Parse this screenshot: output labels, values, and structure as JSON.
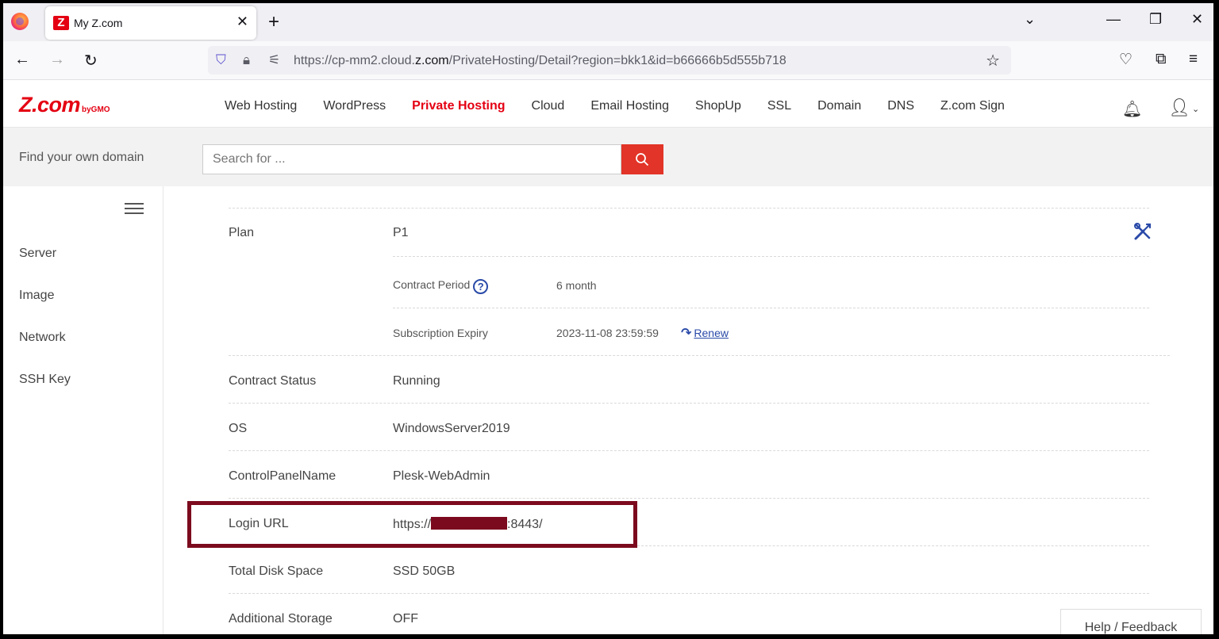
{
  "browser": {
    "tab_title": "My Z.com",
    "tab_favicon": "Z",
    "url_prefix": "https://cp-mm2.cloud.",
    "url_domain": "z.com",
    "url_suffix": "/PrivateHosting/Detail?region=bkk1&id=b66666b5d555b718"
  },
  "site": {
    "logo_text": "Z.com",
    "logo_sub": "byGMO",
    "menu": [
      "Web Hosting",
      "WordPress",
      "Private Hosting",
      "Cloud",
      "Email Hosting",
      "ShopUp",
      "SSL",
      "Domain",
      "DNS",
      "Z.com Sign"
    ],
    "active_menu": "Private Hosting",
    "accent_color": "#e40012"
  },
  "domain_search": {
    "label": "Find your own domain",
    "placeholder": "Search for ..."
  },
  "sidebar": {
    "items": [
      "Server",
      "Image",
      "Network",
      "SSH Key"
    ]
  },
  "details": {
    "plan": {
      "label": "Plan",
      "value": "P1"
    },
    "contract_period": {
      "label": "Contract Period",
      "value": "6 month",
      "help": "?"
    },
    "subscription_expiry": {
      "label": "Subscription Expiry",
      "value": "2023-11-08 23:59:59",
      "renew_label": "Renew"
    },
    "contract_status": {
      "label": "Contract Status",
      "value": "Running"
    },
    "os": {
      "label": "OS",
      "value": "WindowsServer2019"
    },
    "control_panel": {
      "label": "ControlPanelName",
      "value": "Plesk-WebAdmin"
    },
    "login_url": {
      "label": "Login URL",
      "prefix": "https://",
      "suffix": ":8443/"
    },
    "disk": {
      "label": "Total Disk Space",
      "value": "SSD 50GB"
    },
    "storage": {
      "label": "Additional Storage",
      "value": "OFF"
    }
  },
  "feedback_label": "Help / Feedback",
  "colors": {
    "redaction": "#7c0a1e",
    "link": "#2a4aa8",
    "search_button": "#e23428"
  }
}
